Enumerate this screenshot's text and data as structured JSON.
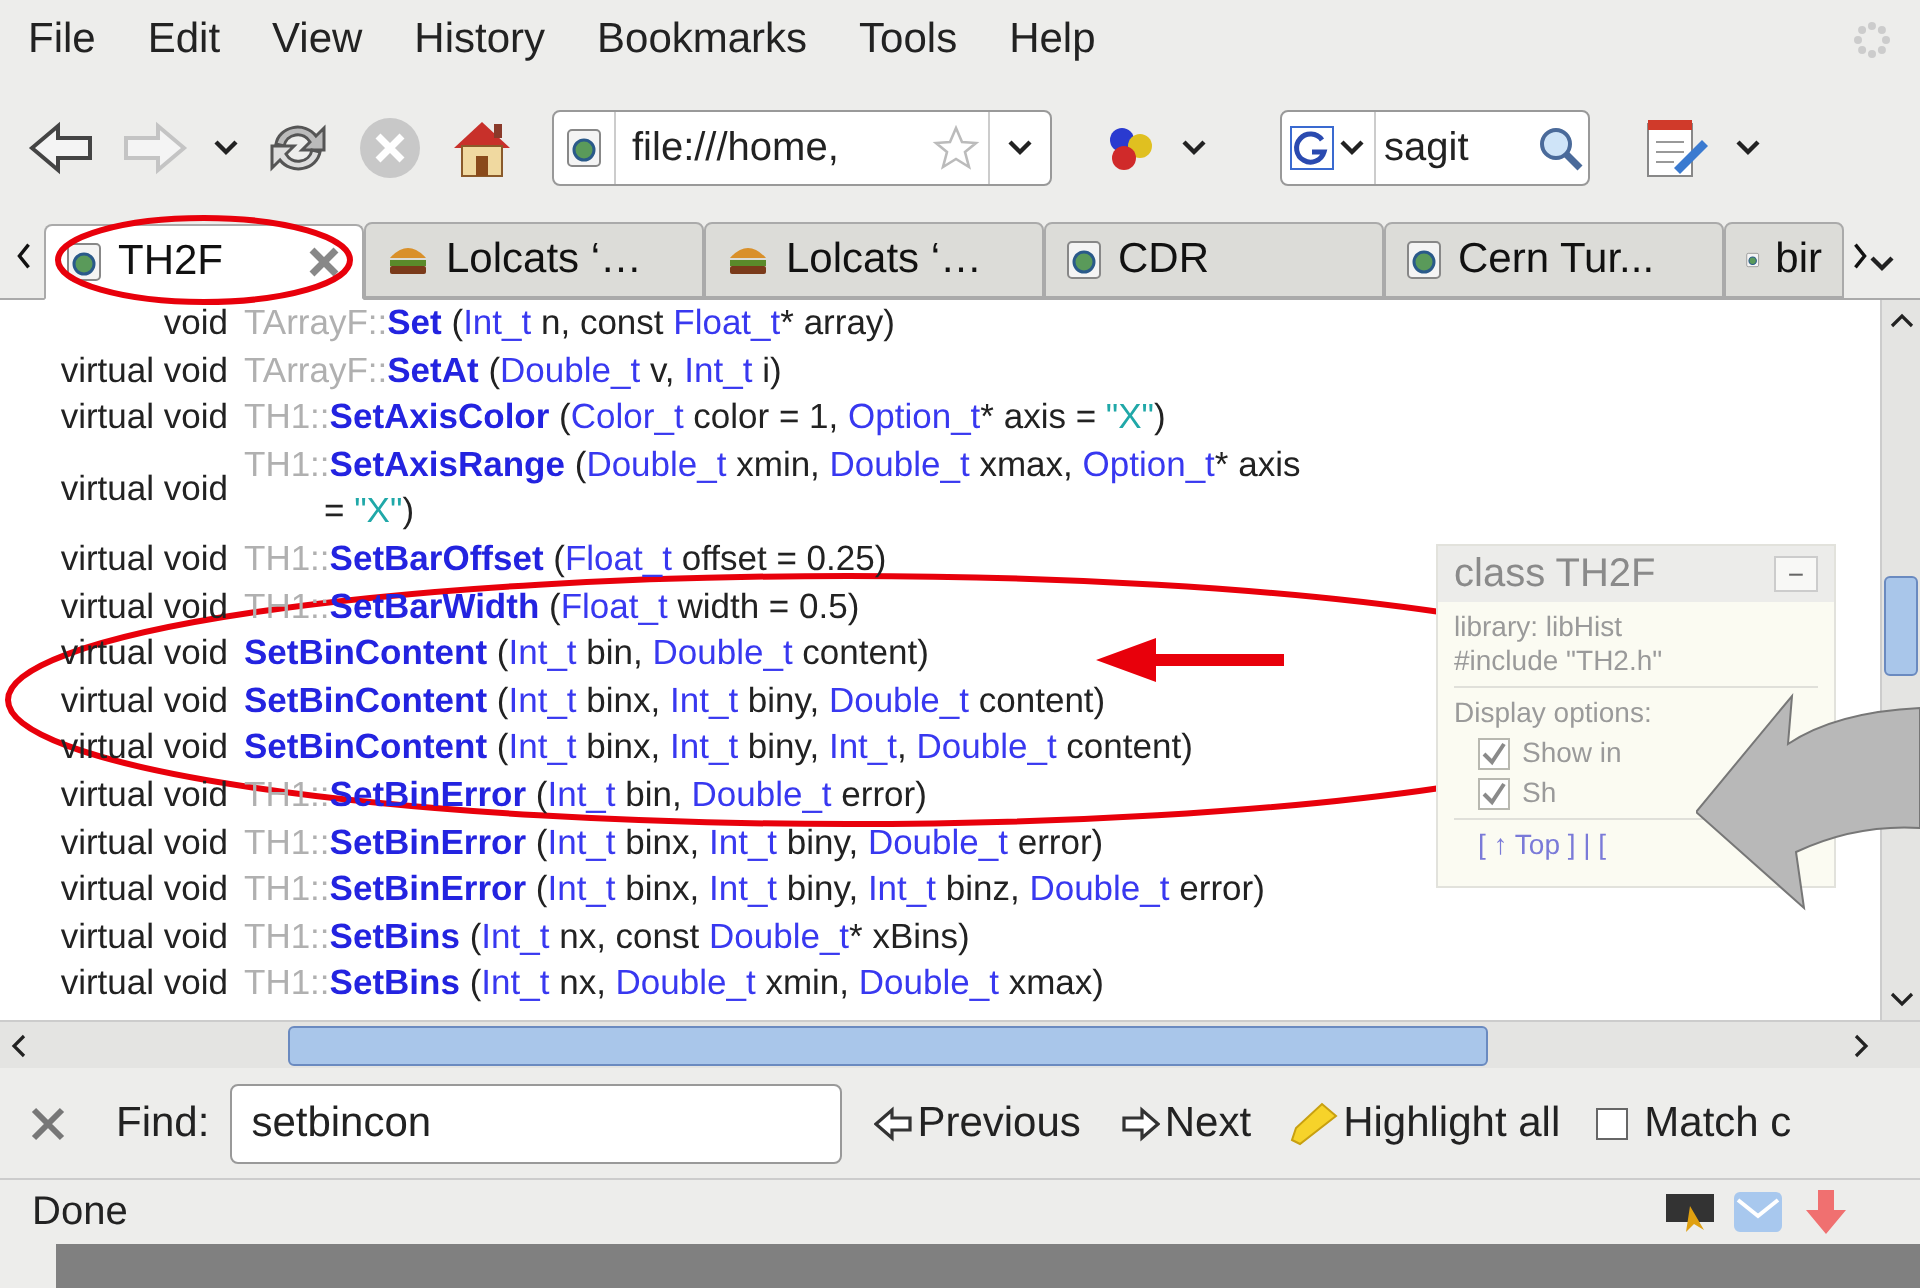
{
  "menu": [
    "File",
    "Edit",
    "View",
    "History",
    "Bookmarks",
    "Tools",
    "Help"
  ],
  "nav": {
    "back_disabled": false,
    "forward_disabled": true,
    "url": "file:///home,",
    "search": "sagit"
  },
  "tabs": [
    {
      "label": "TH2F",
      "selected": true,
      "kind": "page"
    },
    {
      "label": "Lolcats ‘…",
      "selected": false,
      "kind": "food"
    },
    {
      "label": "Lolcats ‘…",
      "selected": false,
      "kind": "food"
    },
    {
      "label": "CDR",
      "selected": false,
      "kind": "page"
    },
    {
      "label": "Cern Tur...",
      "selected": false,
      "kind": "page"
    },
    {
      "label": "bir",
      "selected": false,
      "kind": "page"
    }
  ],
  "rows": [
    {
      "ret": "void",
      "tokens": [
        {
          "kind": "scope",
          "text": "TArrayF::"
        },
        {
          "kind": "name",
          "text": "Set"
        },
        {
          "kind": "plain",
          "text": " ("
        },
        {
          "kind": "type",
          "text": "Int_t"
        },
        {
          "kind": "plain",
          "text": " n, const "
        },
        {
          "kind": "type",
          "text": "Float_t"
        },
        {
          "kind": "plain",
          "text": "* array)"
        }
      ]
    },
    {
      "ret": "virtual void",
      "tokens": [
        {
          "kind": "scope",
          "text": "TArrayF::"
        },
        {
          "kind": "name",
          "text": "SetAt"
        },
        {
          "kind": "plain",
          "text": " ("
        },
        {
          "kind": "type",
          "text": "Double_t"
        },
        {
          "kind": "plain",
          "text": " v, "
        },
        {
          "kind": "type",
          "text": "Int_t"
        },
        {
          "kind": "plain",
          "text": " i)"
        }
      ]
    },
    {
      "ret": "virtual void",
      "tokens": [
        {
          "kind": "scope",
          "text": "TH1::"
        },
        {
          "kind": "name",
          "text": "SetAxisColor"
        },
        {
          "kind": "plain",
          "text": " ("
        },
        {
          "kind": "type",
          "text": "Color_t"
        },
        {
          "kind": "plain",
          "text": " color = 1, "
        },
        {
          "kind": "type",
          "text": "Option_t"
        },
        {
          "kind": "plain",
          "text": "* axis = "
        },
        {
          "kind": "string",
          "text": "\"X\""
        },
        {
          "kind": "plain",
          "text": ")"
        }
      ]
    },
    {
      "ret": "virtual void",
      "tokens": [
        {
          "kind": "scope",
          "text": "TH1::"
        },
        {
          "kind": "name",
          "text": "SetAxisRange"
        },
        {
          "kind": "plain",
          "text": " ("
        },
        {
          "kind": "type",
          "text": "Double_t"
        },
        {
          "kind": "plain",
          "text": " xmin, "
        },
        {
          "kind": "type",
          "text": "Double_t"
        },
        {
          "kind": "plain",
          "text": " xmax, "
        },
        {
          "kind": "type",
          "text": "Option_t"
        },
        {
          "kind": "plain",
          "text": "* axis"
        }
      ],
      "cont": [
        {
          "kind": "plain",
          "text": "= "
        },
        {
          "kind": "string",
          "text": "\"X\""
        },
        {
          "kind": "plain",
          "text": ")"
        }
      ]
    },
    {
      "ret": "virtual void",
      "tokens": [
        {
          "kind": "scope",
          "text": "TH1::"
        },
        {
          "kind": "name",
          "text": "SetBarOffset"
        },
        {
          "kind": "plain",
          "text": " ("
        },
        {
          "kind": "type",
          "text": "Float_t"
        },
        {
          "kind": "plain",
          "text": " offset = 0.25)"
        }
      ]
    },
    {
      "ret": "virtual void",
      "tokens": [
        {
          "kind": "scope",
          "text": "TH1::"
        },
        {
          "kind": "name",
          "text": "SetBarWidth"
        },
        {
          "kind": "plain",
          "text": " ("
        },
        {
          "kind": "type",
          "text": "Float_t"
        },
        {
          "kind": "plain",
          "text": " width = 0.5)"
        }
      ]
    },
    {
      "ret": "virtual void",
      "tokens": [
        {
          "kind": "name",
          "text": "SetBinContent"
        },
        {
          "kind": "plain",
          "text": " ("
        },
        {
          "kind": "type",
          "text": "Int_t"
        },
        {
          "kind": "plain",
          "text": " bin, "
        },
        {
          "kind": "type",
          "text": "Double_t"
        },
        {
          "kind": "plain",
          "text": " content)"
        }
      ]
    },
    {
      "ret": "virtual void",
      "tokens": [
        {
          "kind": "name",
          "text": "SetBinContent"
        },
        {
          "kind": "plain",
          "text": " ("
        },
        {
          "kind": "type",
          "text": "Int_t"
        },
        {
          "kind": "plain",
          "text": " binx, "
        },
        {
          "kind": "type",
          "text": "Int_t"
        },
        {
          "kind": "plain",
          "text": " biny, "
        },
        {
          "kind": "type",
          "text": "Double_t"
        },
        {
          "kind": "plain",
          "text": " content)"
        }
      ]
    },
    {
      "ret": "virtual void",
      "tokens": [
        {
          "kind": "name",
          "text": "SetBinContent"
        },
        {
          "kind": "plain",
          "text": " ("
        },
        {
          "kind": "type",
          "text": "Int_t"
        },
        {
          "kind": "plain",
          "text": " binx, "
        },
        {
          "kind": "type",
          "text": "Int_t"
        },
        {
          "kind": "plain",
          "text": " biny, "
        },
        {
          "kind": "type",
          "text": "Int_t"
        },
        {
          "kind": "plain",
          "text": ", "
        },
        {
          "kind": "type",
          "text": "Double_t"
        },
        {
          "kind": "plain",
          "text": " content)"
        }
      ]
    },
    {
      "ret": "virtual void",
      "tokens": [
        {
          "kind": "scope",
          "text": "TH1::"
        },
        {
          "kind": "name",
          "text": "SetBinError"
        },
        {
          "kind": "plain",
          "text": " ("
        },
        {
          "kind": "type",
          "text": "Int_t"
        },
        {
          "kind": "plain",
          "text": " bin, "
        },
        {
          "kind": "type",
          "text": "Double_t"
        },
        {
          "kind": "plain",
          "text": " error)"
        }
      ]
    },
    {
      "ret": "virtual void",
      "tokens": [
        {
          "kind": "scope",
          "text": "TH1::"
        },
        {
          "kind": "name",
          "text": "SetBinError"
        },
        {
          "kind": "plain",
          "text": " ("
        },
        {
          "kind": "type",
          "text": "Int_t"
        },
        {
          "kind": "plain",
          "text": " binx, "
        },
        {
          "kind": "type",
          "text": "Int_t"
        },
        {
          "kind": "plain",
          "text": " biny, "
        },
        {
          "kind": "type",
          "text": "Double_t"
        },
        {
          "kind": "plain",
          "text": " error)"
        }
      ]
    },
    {
      "ret": "virtual void",
      "tokens": [
        {
          "kind": "scope",
          "text": "TH1::"
        },
        {
          "kind": "name",
          "text": "SetBinError"
        },
        {
          "kind": "plain",
          "text": " ("
        },
        {
          "kind": "type",
          "text": "Int_t"
        },
        {
          "kind": "plain",
          "text": " binx, "
        },
        {
          "kind": "type",
          "text": "Int_t"
        },
        {
          "kind": "plain",
          "text": " biny, "
        },
        {
          "kind": "type",
          "text": "Int_t"
        },
        {
          "kind": "plain",
          "text": " binz, "
        },
        {
          "kind": "type",
          "text": "Double_t"
        },
        {
          "kind": "plain",
          "text": " error)"
        }
      ]
    },
    {
      "ret": "virtual void",
      "tokens": [
        {
          "kind": "scope",
          "text": "TH1::"
        },
        {
          "kind": "name",
          "text": "SetBins"
        },
        {
          "kind": "plain",
          "text": " ("
        },
        {
          "kind": "type",
          "text": "Int_t"
        },
        {
          "kind": "plain",
          "text": " nx, const "
        },
        {
          "kind": "type",
          "text": "Double_t"
        },
        {
          "kind": "plain",
          "text": "* xBins)"
        }
      ]
    },
    {
      "ret": "virtual void",
      "tokens": [
        {
          "kind": "scope",
          "text": "TH1::"
        },
        {
          "kind": "name",
          "text": "SetBins"
        },
        {
          "kind": "plain",
          "text": " ("
        },
        {
          "kind": "type",
          "text": "Int_t"
        },
        {
          "kind": "plain",
          "text": " nx, "
        },
        {
          "kind": "type",
          "text": "Double_t"
        },
        {
          "kind": "plain",
          "text": " xmin, "
        },
        {
          "kind": "type",
          "text": "Double_t"
        },
        {
          "kind": "plain",
          "text": " xmax)"
        }
      ]
    }
  ],
  "panel": {
    "title": "class TH2F",
    "minimize": "−",
    "library": "library: libHist",
    "include": "#include \"TH2.h\"",
    "options_label": "Display options:",
    "options": [
      {
        "label": "Show in",
        "checked": true
      },
      {
        "label": "Sh",
        "checked": true
      }
    ],
    "links": "[ ↑ Top ] | ["
  },
  "find_bar": {
    "label": "Find:",
    "value": "setbincon",
    "previous": "Previous",
    "next": "Next",
    "highlight": "Highlight all",
    "match": {
      "label": "Match c",
      "checked": false
    }
  },
  "status": "Done"
}
